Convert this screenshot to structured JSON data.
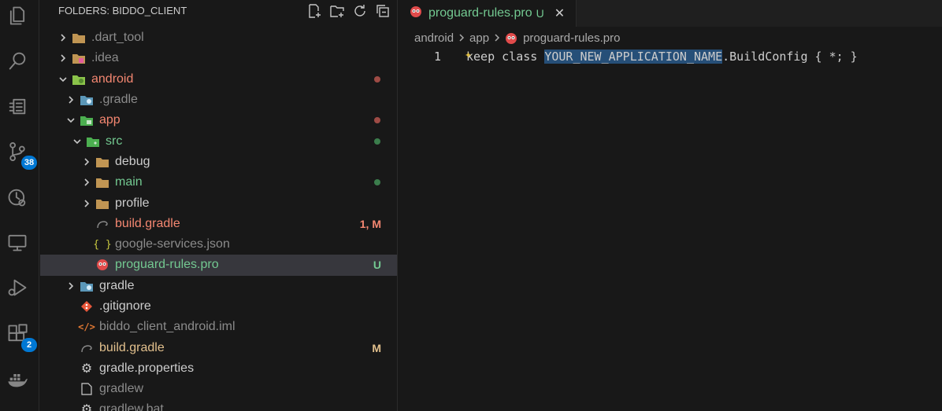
{
  "activity_bar": {
    "items": [
      {
        "name": "explorer-icon"
      },
      {
        "name": "search-icon"
      },
      {
        "name": "outline-icon"
      },
      {
        "name": "source-control-icon",
        "badge": "38"
      },
      {
        "name": "timeline-icon"
      },
      {
        "name": "remote-icon"
      },
      {
        "name": "run-debug-icon"
      },
      {
        "name": "extensions-icon",
        "badge": "2"
      },
      {
        "name": "docker-icon"
      }
    ]
  },
  "sidebar": {
    "title": "FOLDERS: BIDDO_CLIENT",
    "tree": [
      {
        "label": ".dart_tool",
        "indent": 0,
        "chevron": "right",
        "icon": "folder",
        "color": "#8b8b8b"
      },
      {
        "label": ".idea",
        "indent": 0,
        "chevron": "right",
        "icon": "folder-idea",
        "color": "#8b8b8b"
      },
      {
        "label": "android",
        "indent": 0,
        "chevron": "down",
        "icon": "folder-android",
        "color": "#f48771",
        "dot": "#9e4b45"
      },
      {
        "label": ".gradle",
        "indent": 1,
        "chevron": "right",
        "icon": "folder-gradle",
        "color": "#8b8b8b"
      },
      {
        "label": "app",
        "indent": 1,
        "chevron": "down",
        "icon": "folder-app",
        "color": "#f48771",
        "dot": "#9e4b45"
      },
      {
        "label": "src",
        "indent": 2,
        "chevron": "down",
        "icon": "folder-src",
        "color": "#73c991",
        "dot": "#3b7d4c"
      },
      {
        "label": "debug",
        "indent": 3,
        "chevron": "right",
        "icon": "folder",
        "color": "#cccccc"
      },
      {
        "label": "main",
        "indent": 3,
        "chevron": "right",
        "icon": "folder",
        "color": "#73c991",
        "dot": "#3b7d4c"
      },
      {
        "label": "profile",
        "indent": 3,
        "chevron": "right",
        "icon": "folder",
        "color": "#cccccc"
      },
      {
        "label": "build.gradle",
        "indent": 3,
        "chevron": "",
        "icon": "gradle",
        "color": "#f48771",
        "status": "1, M",
        "status_color": "#f48771"
      },
      {
        "label": "google-services.json",
        "indent": 3,
        "chevron": "",
        "icon": "json",
        "color": "#8b8b8b"
      },
      {
        "label": "proguard-rules.pro",
        "indent": 3,
        "chevron": "",
        "icon": "proguard",
        "color": "#73c991",
        "status": "U",
        "status_color": "#73c991",
        "selected": true
      },
      {
        "label": "gradle",
        "indent": 1,
        "chevron": "right",
        "icon": "folder-gradle",
        "color": "#cccccc"
      },
      {
        "label": ".gitignore",
        "indent": 1,
        "chevron": "",
        "icon": "git",
        "color": "#cccccc"
      },
      {
        "label": "biddo_client_android.iml",
        "indent": 1,
        "chevron": "",
        "icon": "xml",
        "color": "#8b8b8b"
      },
      {
        "label": "build.gradle",
        "indent": 1,
        "chevron": "",
        "icon": "gradle",
        "color": "#e2c08d",
        "status": "M",
        "status_color": "#e2c08d"
      },
      {
        "label": "gradle.properties",
        "indent": 1,
        "chevron": "",
        "icon": "gear",
        "color": "#cccccc"
      },
      {
        "label": "gradlew",
        "indent": 1,
        "chevron": "",
        "icon": "file",
        "color": "#8b8b8b"
      },
      {
        "label": "gradlew.bat",
        "indent": 1,
        "chevron": "",
        "icon": "gear",
        "color": "#8b8b8b"
      }
    ]
  },
  "tab": {
    "label": "proguard-rules.pro",
    "status": "U",
    "close": "✕"
  },
  "breadcrumb": [
    "android",
    "app",
    "proguard-rules.pro"
  ],
  "editor": {
    "line_number": "1",
    "code_before": "keep class ",
    "code_highlight": "YOUR_NEW_APPLICATION_NAME",
    "code_after": ".BuildConfig { *; }"
  }
}
